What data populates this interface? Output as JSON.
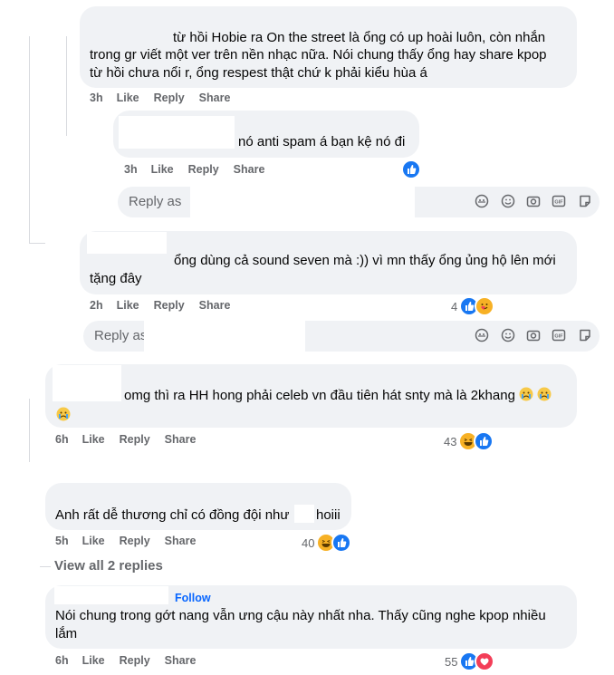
{
  "comments": [
    {
      "id": "c1",
      "lines": [
        "từ hồi Hobie ra On the street là ổng có up hoài luôn, còn nhắn",
        "trong gr viết một ver trên nền nhạc nữa. Nói chung thấy ổng hay share kpop",
        "từ hồi chưa nổi r, ổng respest thật chứ k phải kiểu hùa á"
      ],
      "time": "3h",
      "like": "Like",
      "reply": "Reply",
      "share": "Share"
    },
    {
      "id": "c2",
      "lines": [
        "nó anti spam á bạn kệ nó đi"
      ],
      "time": "3h",
      "like": "Like",
      "reply": "Reply",
      "share": "Share"
    },
    {
      "id": "c3",
      "lines": [
        "ổng dùng cả sound seven mà :)) vì mn thấy ổng ủng hộ lên mới",
        "tặng đây"
      ],
      "time": "2h",
      "like": "Like",
      "reply": "Reply",
      "share": "Share",
      "reaction_count": "4"
    },
    {
      "id": "c4",
      "lines": [
        "omg thì ra HH hong phải celeb vn đầu tiên hát snty mà là 2khang"
      ],
      "time": "6h",
      "like": "Like",
      "reply": "Reply",
      "share": "Share",
      "reaction_count": "43"
    },
    {
      "id": "c5",
      "lines": [
        "Anh rất dễ thương chỉ có đồng đội như",
        "hoiii"
      ],
      "time": "5h",
      "like": "Like",
      "reply": "Reply",
      "share": "Share",
      "reaction_count": "40"
    },
    {
      "id": "c6",
      "follow": "Follow",
      "lines": [
        "Nói chung trong gớt nang vẫn ưng cậu này nhất nha. Thấy cũng nghe kpop nhiều",
        "lắm"
      ],
      "time": "6h",
      "like": "Like",
      "reply": "Reply",
      "share": "Share",
      "reaction_count": "55"
    }
  ],
  "reply_box": {
    "placeholder": "Reply as"
  },
  "view_all": "View all 2 replies",
  "icons": [
    "avatar-sticker-icon",
    "emoji-icon",
    "camera-icon",
    "gif-icon",
    "sticker-icon"
  ],
  "colors": {
    "like": "#1877f2",
    "haha": "#f7b125",
    "love": "#f33e58",
    "bubble": "#f0f2f5",
    "meta": "#65676b",
    "link": "#0866ff"
  }
}
